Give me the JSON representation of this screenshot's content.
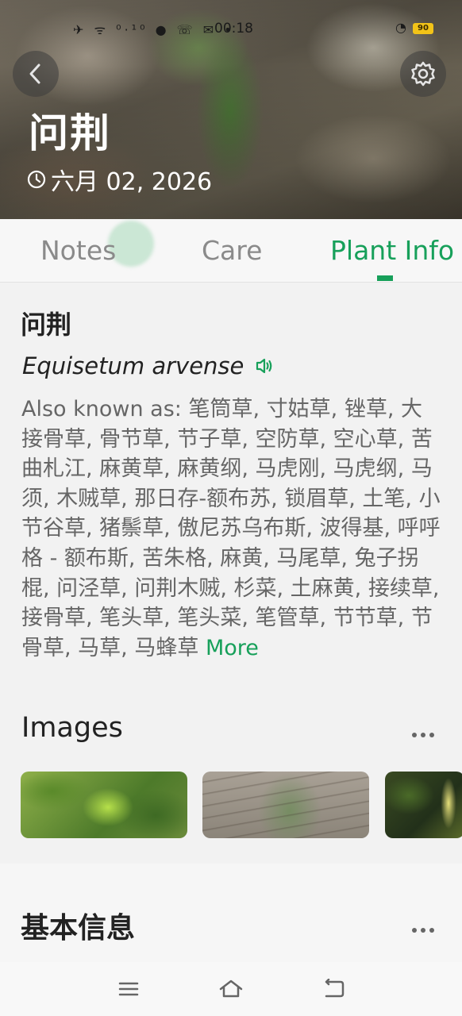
{
  "status_bar": {
    "left_icons": "✈ ᯤ",
    "network_speed": "0.10 KB/s",
    "time": "00:18",
    "battery": "90"
  },
  "header": {
    "title": "问荆",
    "date": "六月 02, 2026",
    "back_icon": "chevron-left-icon",
    "settings_icon": "gear-icon"
  },
  "tabs": [
    {
      "label": "Notes",
      "active": false
    },
    {
      "label": "Care",
      "active": false
    },
    {
      "label": "Plant Info",
      "active": true
    }
  ],
  "plant": {
    "common_name": "问荆",
    "scientific_name": "Equisetum arvense",
    "aka_prefix": "Also known as: ",
    "aka_list": "笔筒草, 寸姑草, 锉草, 大接骨草, 骨节草, 节子草, 空防草, 空心草, 苦曲札江, 麻黄草, 麻黄纲, 马虎刚, 马虎纲, 马须, 木贼草, 那日存-额布苏, 锁眉草, 土笔, 小节谷草, 猪鬃草, 傲尼苏乌布斯, 波得基, 呼呼格 - 额布斯, 苦朱格, 麻黄, 马尾草, 兔子拐棍, 问泾草, 问荆木贼, 杉菜, 土麻黄, 接续草, 接骨草, 笔头草, 笔头菜, 笔管草, 节节草, 节骨草, 马草, 马蜂草",
    "more_label": "More"
  },
  "images_section": {
    "title": "Images",
    "thumbnails": [
      "plant-photo-1",
      "plant-photo-2",
      "plant-photo-3"
    ]
  },
  "basic_info": {
    "title": "基本信息"
  },
  "colors": {
    "accent": "#17a05a",
    "battery": "#f2c318"
  }
}
